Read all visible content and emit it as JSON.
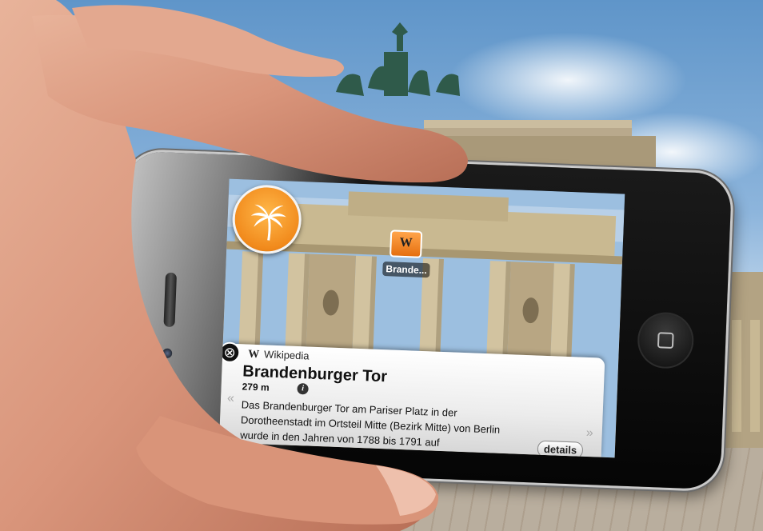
{
  "ar_app": {
    "marker": {
      "icon": "wikipedia-w-icon",
      "glyph": "W",
      "label": "Brande..."
    },
    "category_badge": {
      "icon": "palm-tree-icon"
    },
    "info_panel": {
      "close_glyph": "⊗",
      "source_glyph": "W",
      "source": "Wikipedia",
      "title": "Brandenburger Tor",
      "distance": "279 m",
      "info_glyph": "i",
      "prev_glyph": "«",
      "next_glyph": "»",
      "description": "Das Brandenburger Tor am Pariser Platz in der Dorotheenstadt im Ortsteil Mitte (Bezirk Mitte) von Berlin wurde in den Jahren von 1788 bis 1791 auf",
      "details_label": "details"
    }
  },
  "colors": {
    "accent_orange": "#f18a1c",
    "panel_bg": "#ececec"
  }
}
